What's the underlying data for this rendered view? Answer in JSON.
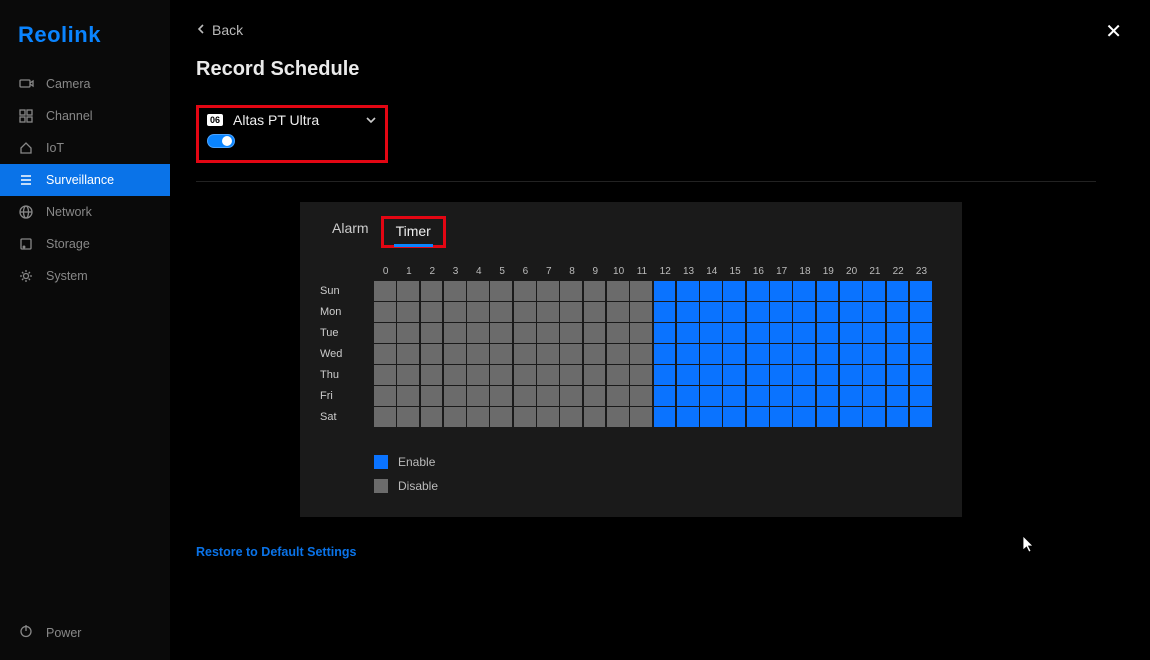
{
  "brand": "Reolink",
  "sidebar": {
    "items": [
      {
        "label": "Camera"
      },
      {
        "label": "Channel"
      },
      {
        "label": "IoT"
      },
      {
        "label": "Surveillance"
      },
      {
        "label": "Network"
      },
      {
        "label": "Storage"
      },
      {
        "label": "System"
      }
    ],
    "active_index": 3,
    "power": "Power"
  },
  "header": {
    "back": "Back",
    "title": "Record Schedule"
  },
  "device_select": {
    "num": "06",
    "name": "Altas PT Ultra",
    "enabled": true
  },
  "tabs": [
    {
      "label": "Alarm",
      "active": false
    },
    {
      "label": "Timer",
      "active": true
    }
  ],
  "schedule": {
    "hours": [
      "0",
      "1",
      "2",
      "3",
      "4",
      "5",
      "6",
      "7",
      "8",
      "9",
      "10",
      "11",
      "12",
      "13",
      "14",
      "15",
      "16",
      "17",
      "18",
      "19",
      "20",
      "21",
      "22",
      "23"
    ],
    "days": [
      "Sun",
      "Mon",
      "Tue",
      "Wed",
      "Thu",
      "Fri",
      "Sat"
    ],
    "split_hour": 12
  },
  "legend": {
    "enable": "Enable",
    "disable": "Disable"
  },
  "restore": "Restore to Default Settings"
}
